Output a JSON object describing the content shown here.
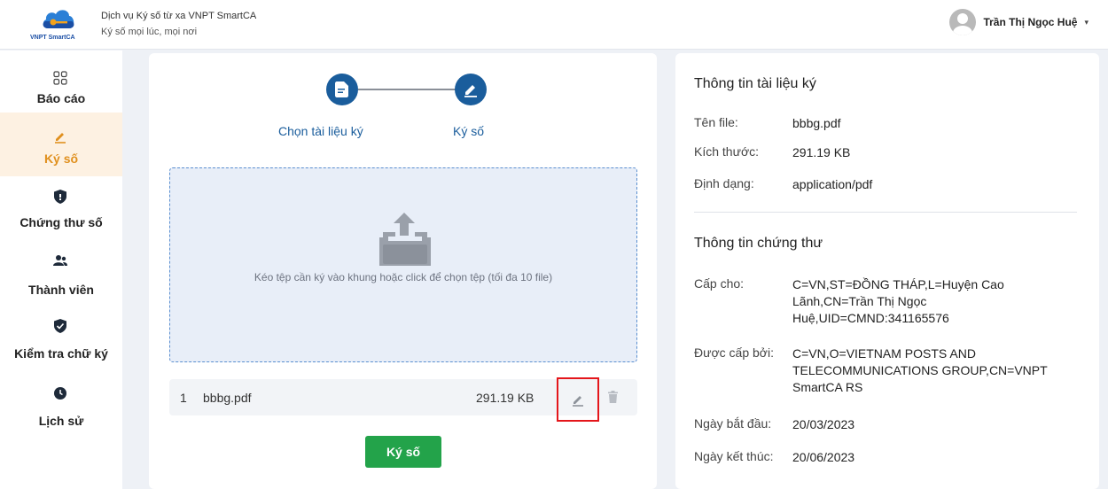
{
  "header": {
    "logo_text": "VNPT SmartCA",
    "title": "Dịch vụ Ký số từ xa VNPT SmartCA",
    "subtitle": "Ký số mọi lúc, mọi nơi",
    "user_name": "Trần Thị Ngọc Huệ",
    "user_caret": "▾"
  },
  "sidebar": {
    "items": [
      {
        "label": "Báo cáo",
        "icon": "grid-icon",
        "active": false
      },
      {
        "label": "Ký số",
        "icon": "pen-icon",
        "active": true
      },
      {
        "label": "Chứng thư số",
        "icon": "shield-icon",
        "active": false
      },
      {
        "label": "Thành viên",
        "icon": "users-icon",
        "active": false
      },
      {
        "label": "Kiểm tra chữ ký",
        "icon": "shield-check-icon",
        "active": false
      },
      {
        "label": "Lịch sử",
        "icon": "clock-icon",
        "active": false
      }
    ]
  },
  "steps": {
    "step1_label": "Chọn tài liệu ký",
    "step2_label": "Ký số"
  },
  "dropzone": {
    "text": "Kéo tệp cần ký vào khung hoặc click để chọn tệp (tối đa 10 file)"
  },
  "files": [
    {
      "index": "1",
      "name": "bbbg.pdf",
      "size": "291.19 KB"
    }
  ],
  "sign_button_label": "Ký số",
  "doc_info": {
    "title": "Thông tin tài liệu ký",
    "filename_label": "Tên file:",
    "filename_value": "bbbg.pdf",
    "size_label": "Kích thước:",
    "size_value": "291.19 KB",
    "format_label": "Định dạng:",
    "format_value": "application/pdf"
  },
  "cert_info": {
    "title": "Thông tin chứng thư",
    "issued_to_label": "Cấp cho:",
    "issued_to_value": "C=VN,ST=ĐỒNG THÁP,L=Huyện Cao Lãnh,CN=Trần Thị Ngọc Huệ,UID=CMND:341165576",
    "issued_by_label": "Được cấp bởi:",
    "issued_by_value": "C=VN,O=VIETNAM POSTS AND TELECOMMUNICATIONS GROUP,CN=VNPT SmartCA RS",
    "start_label": "Ngày bắt đầu:",
    "start_value": "20/03/2023",
    "end_label": "Ngày kết thúc:",
    "end_value": "20/06/2023"
  },
  "colors": {
    "primary": "#1a5d9c",
    "accent": "#e0901e",
    "success": "#23a34a",
    "highlight": "#e4161b"
  }
}
